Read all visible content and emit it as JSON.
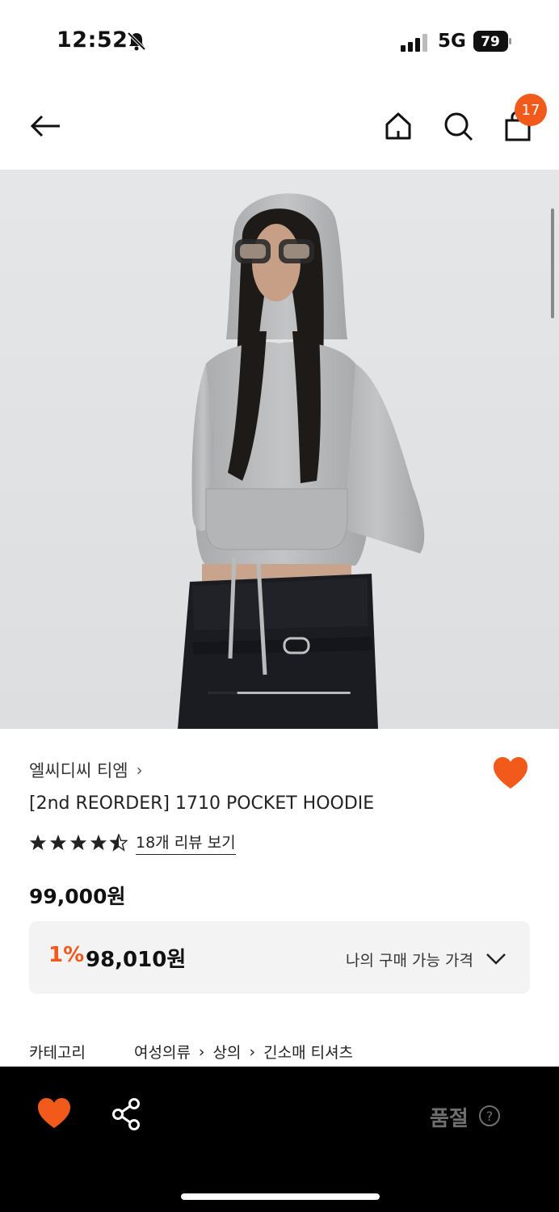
{
  "status_bar": {
    "time": "12:52",
    "network": "5G",
    "battery": "79"
  },
  "header": {
    "cart_count": "17"
  },
  "hero": {
    "image_alt": "model wearing grey cropped hoodie"
  },
  "product": {
    "brand": "엘씨디씨 티엠",
    "brand_arrow": "›",
    "name": "[2nd REORDER] 1710 POCKET HOODIE",
    "rating_stars": 4.5,
    "review_link": "18개 리뷰 보기",
    "price": "99,000원",
    "discount_rate": "1%",
    "discount_price": "98,010원",
    "my_price_label": "나의 구매 가능 가격"
  },
  "category": {
    "label": "카테고리",
    "crumbs": [
      "여성의류",
      "상의",
      "긴소매 티셔츠"
    ],
    "separator": "›"
  },
  "bottom_bar": {
    "status_label": "품절"
  },
  "colors": {
    "accent": "#f15a1a",
    "dark": "#000000",
    "muted": "#6f6f6f"
  }
}
